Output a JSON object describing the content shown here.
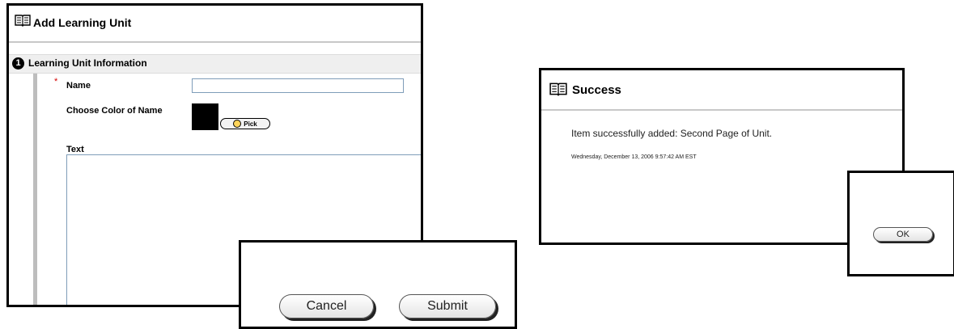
{
  "add_unit": {
    "title": "Add Learning Unit",
    "section": {
      "step": "1",
      "title": "Learning Unit Information"
    },
    "fields": {
      "required_marker": "*",
      "name_label": "Name",
      "name_value": "",
      "color_label": "Choose Color of Name",
      "color_value": "#000000",
      "pick_label": "Pick",
      "text_label": "Text",
      "text_value": ""
    },
    "buttons": {
      "cancel": "Cancel",
      "submit": "Submit"
    }
  },
  "success": {
    "title": "Success",
    "message": "Item successfully added: Second Page of Unit.",
    "timestamp": "Wednesday, December 13, 2006 9:57:42 AM EST",
    "ok": "OK"
  },
  "icons": {
    "header": "book-icon",
    "pick": "color-wheel-icon"
  },
  "colors": {
    "required": "#d40000",
    "section_bar": "#efefef",
    "rule": "#bdbdbd",
    "input_border": "#7f9db9"
  }
}
